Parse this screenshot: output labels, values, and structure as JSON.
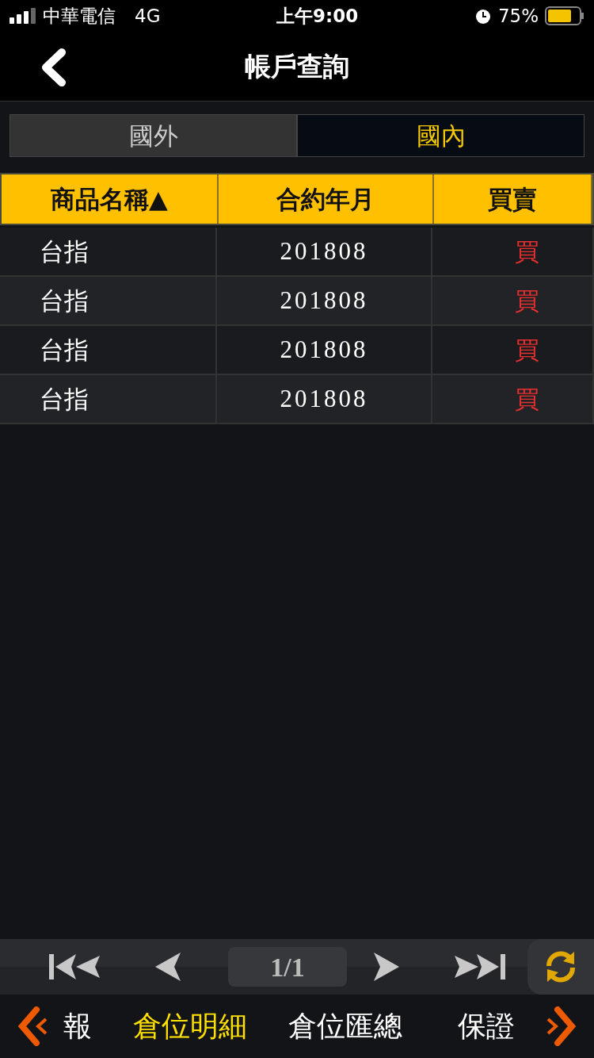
{
  "status_bar": {
    "carrier": "中華電信",
    "network": "4G",
    "time": "上午9:00",
    "battery": "75%"
  },
  "nav": {
    "title": "帳戶查詢"
  },
  "tabs": [
    {
      "label": "國外",
      "selected": false
    },
    {
      "label": "國內",
      "selected": true
    }
  ],
  "table": {
    "columns": [
      "商品名稱▲",
      "合約年月",
      "買賣"
    ],
    "rows": [
      [
        "台指",
        "201808",
        "買"
      ],
      [
        "台指",
        "201808",
        "買"
      ],
      [
        "台指",
        "201808",
        "買"
      ],
      [
        "台指",
        "201808",
        "買"
      ]
    ]
  },
  "pager": {
    "page": "1/1"
  },
  "bottom_menu": [
    {
      "label": "報",
      "selected": false
    },
    {
      "label": "倉位明細",
      "selected": true
    },
    {
      "label": "倉位匯總",
      "selected": false
    },
    {
      "label": "保證",
      "selected": false
    }
  ]
}
